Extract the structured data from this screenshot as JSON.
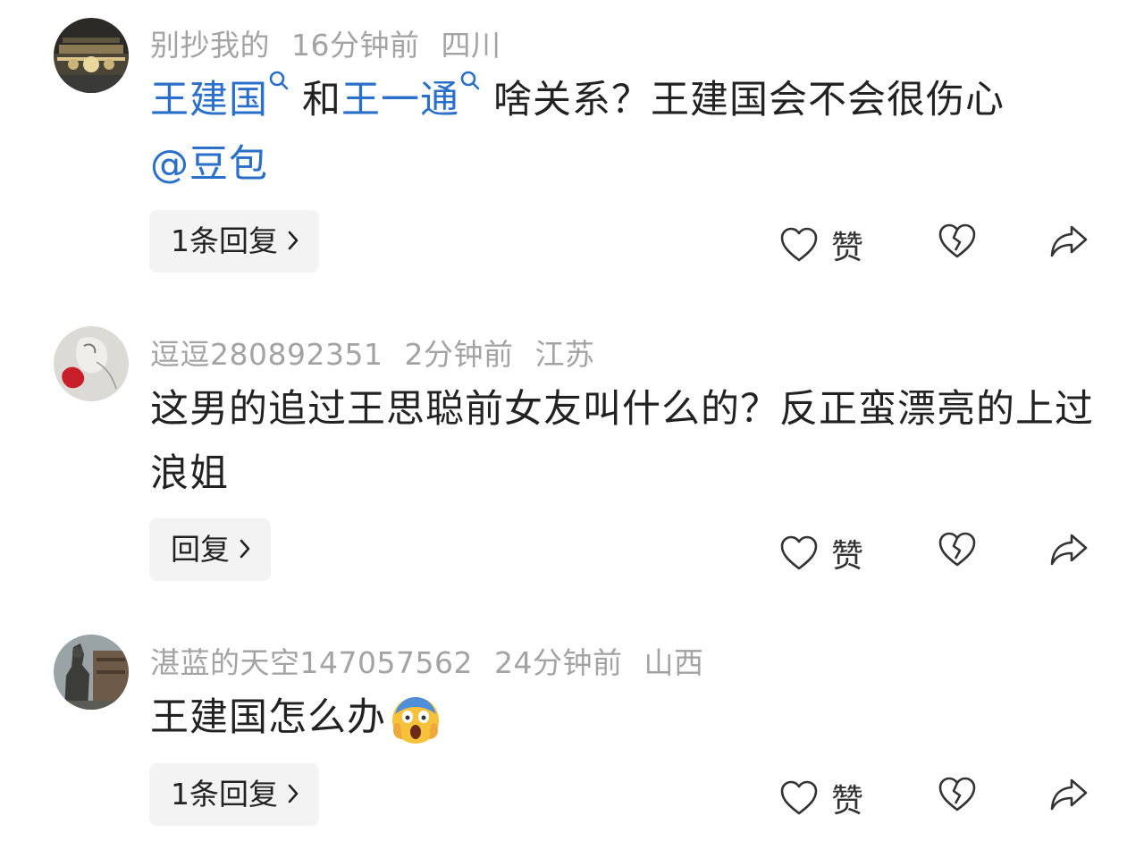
{
  "comments": [
    {
      "username": "别抄我的",
      "time": "16分钟前",
      "location": "四川",
      "text": {
        "link1": "王建国",
        "mid1": "和",
        "link2": "王一通",
        "rest": "啥关系？王建国会不会很伤心",
        "mention": "@豆包"
      },
      "reply_label": "1条回复",
      "like_label": "赞"
    },
    {
      "username": "逗逗280892351",
      "time": "2分钟前",
      "location": "江苏",
      "text": "这男的追过王思聪前女友叫什么的？反正蛮漂亮的上过浪姐",
      "reply_label": "回复",
      "like_label": "赞"
    },
    {
      "username": "湛蓝的天空147057562",
      "time": "24分钟前",
      "location": "山西",
      "text": "王建国怎么办",
      "emoji": "screaming-face",
      "reply_label": "1条回复",
      "like_label": "赞"
    }
  ],
  "colors": {
    "link": "#2a6fc9",
    "meta": "#a3a3a3",
    "text": "#222222",
    "reply_bg": "#f3f3f3"
  },
  "icons": [
    "search-icon",
    "heart-icon",
    "broken-heart-icon",
    "share-icon",
    "chevron-right-icon"
  ]
}
